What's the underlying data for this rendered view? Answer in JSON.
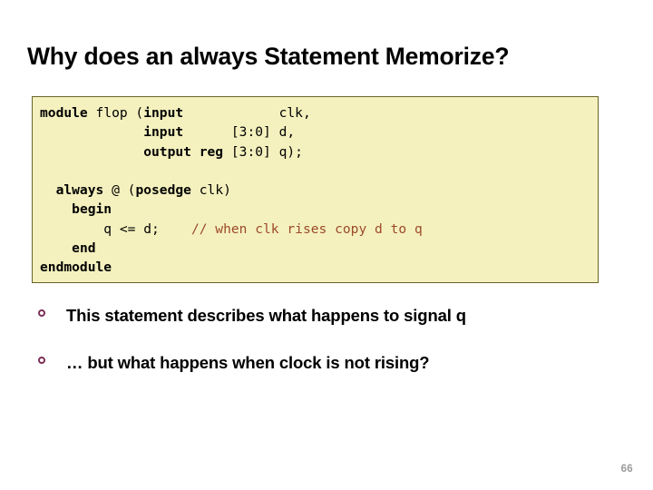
{
  "slide": {
    "title": "Why does an always Statement Memorize?",
    "page_number": "66",
    "bullet_glyph": "circle-outline",
    "colors": {
      "code_background": "#F4F1BE",
      "code_border": "#6B6329",
      "comment_text": "#9C4A2A",
      "bullet_marker": "#7C2E55",
      "page_number": "#9A9A9A",
      "body_text": "#000000"
    }
  },
  "code_block": {
    "language": "verilog",
    "lines": [
      {
        "id": "line-1",
        "text": "module flop (input            clk,",
        "segments": [
          {
            "text": "module",
            "style": "keyword"
          },
          {
            "text": " flop (",
            "style": "plain"
          },
          {
            "text": "input",
            "style": "keyword"
          },
          {
            "text": "            clk,",
            "style": "plain"
          }
        ]
      },
      {
        "id": "line-2",
        "text": "             input      [3:0] d,",
        "segments": [
          {
            "text": "             ",
            "style": "plain"
          },
          {
            "text": "input",
            "style": "keyword"
          },
          {
            "text": "      [3:0] d,",
            "style": "plain"
          }
        ]
      },
      {
        "id": "line-3",
        "text": "             output reg [3:0] q);",
        "segments": [
          {
            "text": "             ",
            "style": "plain"
          },
          {
            "text": "output reg",
            "style": "keyword"
          },
          {
            "text": " [3:0] q);",
            "style": "plain"
          }
        ]
      },
      {
        "id": "line-4",
        "text": "",
        "segments": []
      },
      {
        "id": "line-5",
        "text": "  always @ (posedge clk)",
        "segments": [
          {
            "text": "  ",
            "style": "plain"
          },
          {
            "text": "always",
            "style": "keyword"
          },
          {
            "text": " @ (",
            "style": "plain"
          },
          {
            "text": "posedge",
            "style": "keyword"
          },
          {
            "text": " clk)",
            "style": "plain"
          }
        ]
      },
      {
        "id": "line-6",
        "text": "    begin",
        "segments": [
          {
            "text": "    ",
            "style": "plain"
          },
          {
            "text": "begin",
            "style": "keyword"
          }
        ]
      },
      {
        "id": "line-7",
        "text": "        q <= d;    // when clk rises copy d to q",
        "segments": [
          {
            "text": "        q <= d;    ",
            "style": "plain"
          },
          {
            "text": "// when clk rises copy d to q",
            "style": "comment"
          }
        ]
      },
      {
        "id": "line-8",
        "text": "    end",
        "segments": [
          {
            "text": "    ",
            "style": "plain"
          },
          {
            "text": "end",
            "style": "keyword"
          }
        ]
      },
      {
        "id": "line-9",
        "text": "endmodule",
        "segments": [
          {
            "text": "endmodule",
            "style": "keyword"
          }
        ]
      }
    ]
  },
  "bullets": [
    {
      "id": "bullet-1",
      "text": "This statement describes what happens to signal q"
    },
    {
      "id": "bullet-2",
      "text": "… but what happens when clock is not rising?"
    }
  ]
}
